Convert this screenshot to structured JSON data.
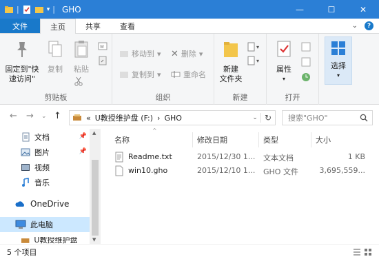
{
  "window": {
    "title": "GHO",
    "controls": {
      "minimize": "—",
      "maximize": "☐",
      "close": "✕"
    }
  },
  "tabs": {
    "file": "文件",
    "home": "主页",
    "share": "共享",
    "view": "查看"
  },
  "ribbon": {
    "clipboard": {
      "label": "剪贴板",
      "pin": "固定到\"快\n速访问\"",
      "pin_l1": "固定到\"快",
      "pin_l2": "速访问\"",
      "copy": "复制",
      "paste": "粘贴"
    },
    "organize": {
      "label": "组织",
      "move_to": "移动到",
      "copy_to": "复制到",
      "delete": "删除",
      "rename": "重命名"
    },
    "new": {
      "label": "新建",
      "new_folder_l1": "新建",
      "new_folder_l2": "文件夹"
    },
    "open": {
      "label": "打开",
      "properties": "属性"
    },
    "select": {
      "label": "选择"
    }
  },
  "address": {
    "prefix": "«",
    "drive": "U教授维护盘 (F:)",
    "sep": "›",
    "folder": "GHO",
    "search_placeholder": "搜索\"GHO\""
  },
  "nav": {
    "items": [
      {
        "label": "文档",
        "pinned": true
      },
      {
        "label": "图片",
        "pinned": true
      },
      {
        "label": "视频",
        "pinned": false
      },
      {
        "label": "音乐",
        "pinned": false
      },
      {
        "label": "OneDrive",
        "pinned": false
      },
      {
        "label": "此电脑",
        "pinned": false
      },
      {
        "label": "U教授维护盘 (F:)",
        "pinned": false
      }
    ]
  },
  "list": {
    "columns": {
      "name": "名称",
      "date": "修改日期",
      "type": "类型",
      "size": "大小"
    },
    "rows": [
      {
        "name": "Readme.txt",
        "date": "2015/12/30 1...",
        "type": "文本文档",
        "size": "1 KB"
      },
      {
        "name": "win10.gho",
        "date": "2015/12/10 1...",
        "type": "GHO 文件",
        "size": "3,695,559..."
      }
    ]
  },
  "status": {
    "count": "5 个项目"
  },
  "colors": {
    "titlebar": "#2b7fd6",
    "file_tab": "#1979ca",
    "selected": "#cce8ff"
  }
}
